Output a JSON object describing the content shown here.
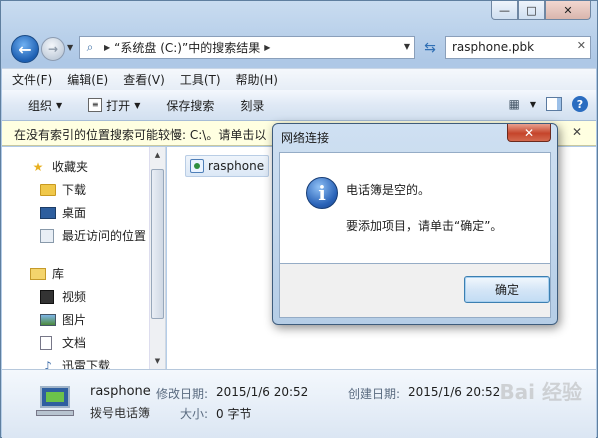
{
  "window": {
    "minimize": "—",
    "maximize": "□",
    "close": "✕"
  },
  "nav": {
    "address_path": "“系统盘 (C:)”中的搜索结果",
    "search_value": "rasphone.pbk"
  },
  "menu": [
    "文件(F)",
    "编辑(E)",
    "查看(V)",
    "工具(T)",
    "帮助(H)"
  ],
  "toolbar": {
    "organize": "组织",
    "open": "打开",
    "save_search": "保存搜索",
    "burn": "刻录"
  },
  "info_bar": {
    "text": "在没有索引的位置搜索可能较慢: C:\\。请单击以"
  },
  "sidebar": {
    "favorites": "收藏夹",
    "downloads": "下载",
    "desktop": "桌面",
    "recent": "最近访问的位置",
    "libraries": "库",
    "videos": "视频",
    "pictures": "图片",
    "documents": "文档",
    "music": "迅雷下载"
  },
  "content": {
    "file_name": "rasphone"
  },
  "details": {
    "name": "rasphone",
    "type": "拨号电话簿",
    "modified_label": "修改日期:",
    "modified_value": "2015/1/6 20:52",
    "created_label": "创建日期:",
    "created_value": "2015/1/6 20:52",
    "size_label": "大小:",
    "size_value": "0 字节",
    "watermark": "Bai 经验"
  },
  "dialog": {
    "title": "网络连接",
    "close": "✕",
    "message_line1": "电话簿是空的。",
    "message_line2": "要添加项目，请单击“确定”。",
    "ok_label": "确定"
  }
}
